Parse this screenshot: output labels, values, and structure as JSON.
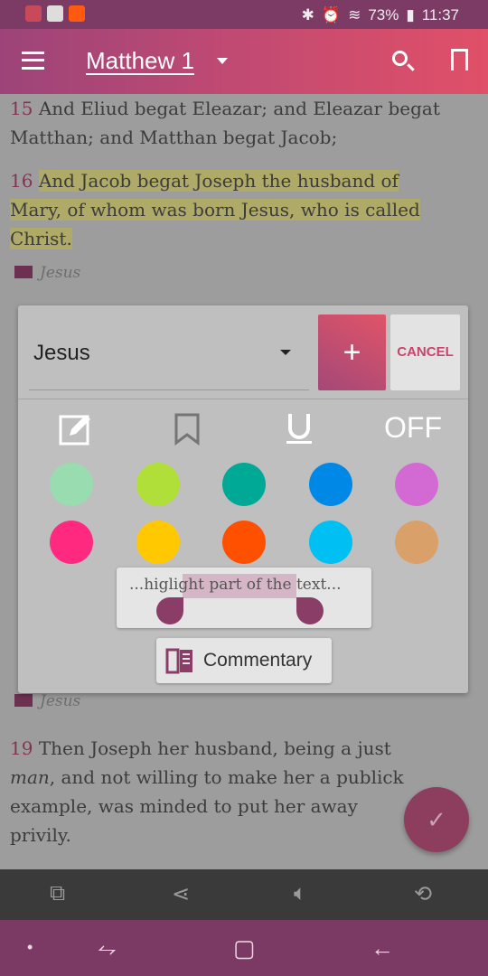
{
  "status_bar": {
    "battery": "73%",
    "time": "11:37"
  },
  "app_bar": {
    "title": "Matthew 1",
    "icons": [
      "menu-icon",
      "search-icon",
      "bookmark-icon"
    ]
  },
  "verses": [
    {
      "num": "15",
      "text": "And Eliud begat Eleazar; and Eleazar begat Matthan; and Matthan begat Jacob;"
    },
    {
      "num": "16",
      "text": "And Jacob begat Joseph the husband of Mary, of whom was born Jesus, who is called Christ.",
      "tag": "Jesus"
    },
    {
      "tag": "Jesus"
    },
    {
      "num": "19",
      "text_before": "Then Joseph her husband, being a just ",
      "italic": "man",
      "text_after": ", and not willing to make her a publick example, was minded to put her away privily."
    }
  ],
  "dialog": {
    "tag_select": "Jesus",
    "add_label": "+",
    "cancel_label": "CANCEL",
    "off_label": "OFF",
    "colors": [
      "#98dcaf",
      "#b0df3a",
      "#00a896",
      "#0088e6",
      "#d36ad3",
      "#ff2a7f",
      "#ffc800",
      "#ff5000",
      "#00bff2",
      "#d9a06a"
    ],
    "preview_text": "...higlight part of the text...",
    "commentary_label": "Commentary"
  },
  "fab": {
    "icon": "check-icon"
  },
  "bottom_toolbar": [
    "copy-icon",
    "share-icon",
    "volume-icon",
    "replay-icon"
  ]
}
